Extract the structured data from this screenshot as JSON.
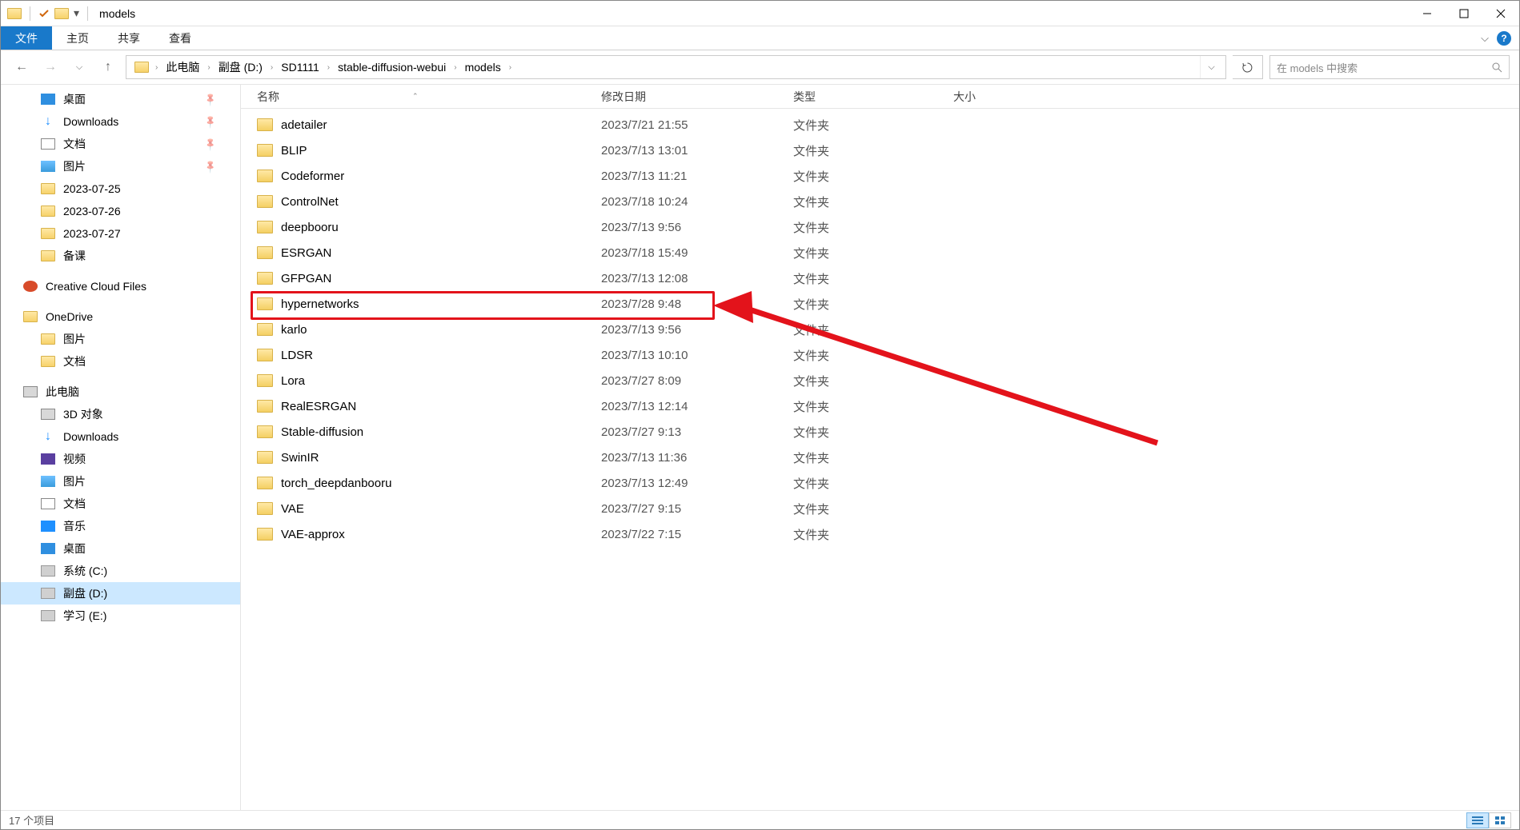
{
  "window": {
    "title": "models"
  },
  "ribbon": {
    "file": "文件",
    "tabs": [
      "主页",
      "共享",
      "查看"
    ]
  },
  "breadcrumbs": [
    "此电脑",
    "副盘 (D:)",
    "SD1111",
    "stable-diffusion-webui",
    "models"
  ],
  "search": {
    "placeholder": "在 models 中搜索"
  },
  "sidebar": {
    "quick": [
      {
        "label": "桌面",
        "icon": "desktop",
        "pinned": true
      },
      {
        "label": "Downloads",
        "icon": "download",
        "pinned": true
      },
      {
        "label": "文档",
        "icon": "doc",
        "pinned": true
      },
      {
        "label": "图片",
        "icon": "img",
        "pinned": true
      },
      {
        "label": "2023-07-25",
        "icon": "folder"
      },
      {
        "label": "2023-07-26",
        "icon": "folder"
      },
      {
        "label": "2023-07-27",
        "icon": "folder"
      },
      {
        "label": "备课",
        "icon": "folder"
      }
    ],
    "creative_cloud": "Creative Cloud Files",
    "onedrive": {
      "label": "OneDrive",
      "children": [
        "图片",
        "文档"
      ]
    },
    "this_pc": {
      "label": "此电脑",
      "children": [
        {
          "label": "3D 对象",
          "icon": "pc"
        },
        {
          "label": "Downloads",
          "icon": "download"
        },
        {
          "label": "视频",
          "icon": "video"
        },
        {
          "label": "图片",
          "icon": "img"
        },
        {
          "label": "文档",
          "icon": "doc"
        },
        {
          "label": "音乐",
          "icon": "music"
        },
        {
          "label": "桌面",
          "icon": "desktop"
        },
        {
          "label": "系统 (C:)",
          "icon": "drive"
        },
        {
          "label": "副盘 (D:)",
          "icon": "drive",
          "selected": true
        },
        {
          "label": "学习 (E:)",
          "icon": "drive"
        }
      ]
    }
  },
  "columns": {
    "name": "名称",
    "date": "修改日期",
    "type": "类型",
    "size": "大小"
  },
  "folder_type_label": "文件夹",
  "files": [
    {
      "name": "adetailer",
      "date": "2023/7/21 21:55"
    },
    {
      "name": "BLIP",
      "date": "2023/7/13 13:01"
    },
    {
      "name": "Codeformer",
      "date": "2023/7/13 11:21"
    },
    {
      "name": "ControlNet",
      "date": "2023/7/18 10:24"
    },
    {
      "name": "deepbooru",
      "date": "2023/7/13 9:56"
    },
    {
      "name": "ESRGAN",
      "date": "2023/7/18 15:49"
    },
    {
      "name": "GFPGAN",
      "date": "2023/7/13 12:08"
    },
    {
      "name": "hypernetworks",
      "date": "2023/7/28 9:48",
      "highlight": true
    },
    {
      "name": "karlo",
      "date": "2023/7/13 9:56"
    },
    {
      "name": "LDSR",
      "date": "2023/7/13 10:10"
    },
    {
      "name": "Lora",
      "date": "2023/7/27 8:09"
    },
    {
      "name": "RealESRGAN",
      "date": "2023/7/13 12:14"
    },
    {
      "name": "Stable-diffusion",
      "date": "2023/7/27 9:13"
    },
    {
      "name": "SwinIR",
      "date": "2023/7/13 11:36"
    },
    {
      "name": "torch_deepdanbooru",
      "date": "2023/7/13 12:49"
    },
    {
      "name": "VAE",
      "date": "2023/7/27 9:15"
    },
    {
      "name": "VAE-approx",
      "date": "2023/7/22 7:15"
    }
  ],
  "status": {
    "item_count": "17 个项目"
  },
  "annotation": {
    "highlighted_folder": "hypernetworks"
  }
}
